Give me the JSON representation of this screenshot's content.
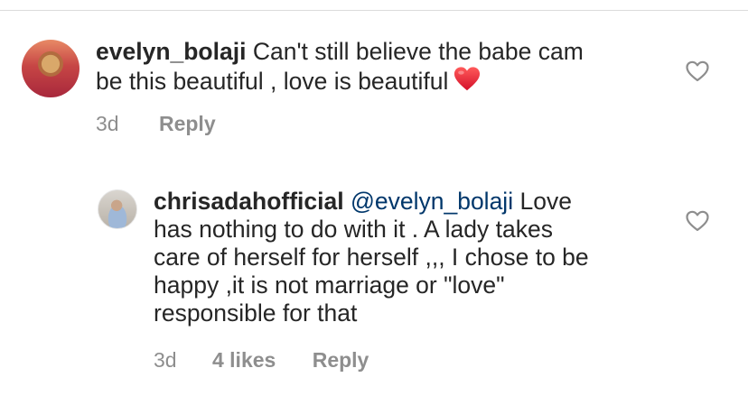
{
  "comments": [
    {
      "username": "evelyn_bolaji",
      "text_line1": "Can't still believe the babe cam",
      "text_line2": "be this beautiful , love is beautiful",
      "emoji": "red-heart-emoji",
      "time": "3d",
      "reply_label": "Reply"
    }
  ],
  "reply": {
    "username": "chrisadahofficial",
    "mention": "@evelyn_bolaji",
    "line1_rest": "Love",
    "line2": "has nothing to do with it . A lady takes",
    "line3": "care of herself for herself ,,, I chose to be",
    "line4": "happy ,it is not marriage or \"love\"",
    "line5": "responsible for that",
    "time": "3d",
    "likes_label": "4 likes",
    "reply_label": "Reply"
  },
  "icons": {
    "like": "heart-outline-icon"
  },
  "colors": {
    "text": "#262626",
    "secondary": "#8e8e8e",
    "mention": "#00376b",
    "divider": "#dbdbdb",
    "emoji_heart": "#e0245e"
  }
}
